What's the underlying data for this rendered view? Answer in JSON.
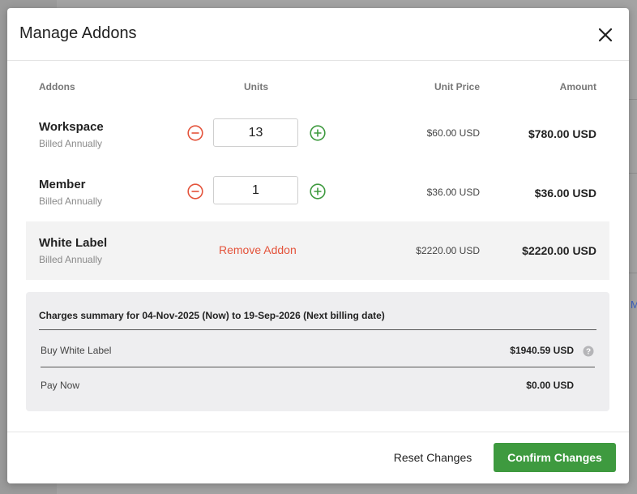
{
  "modal": {
    "title": "Manage Addons"
  },
  "table": {
    "headers": {
      "addons": "Addons",
      "units": "Units",
      "unit_price": "Unit Price",
      "amount": "Amount"
    },
    "rows": [
      {
        "name": "Workspace",
        "billing": "Billed Annually",
        "units": "13",
        "unit_price": "$60.00 USD",
        "amount": "$780.00 USD"
      },
      {
        "name": "Member",
        "billing": "Billed Annually",
        "units": "1",
        "unit_price": "$36.00 USD",
        "amount": "$36.00 USD"
      },
      {
        "name": "White Label",
        "billing": "Billed Annually",
        "action": "Remove Addon",
        "unit_price": "$2220.00 USD",
        "amount": "$2220.00 USD"
      }
    ]
  },
  "summary": {
    "title": "Charges summary for 04-Nov-2025 (Now) to 19-Sep-2026 (Next billing date)",
    "lines": [
      {
        "label": "Buy White Label",
        "value": "$1940.59 USD"
      },
      {
        "label": "Pay Now",
        "value": "$0.00 USD"
      }
    ]
  },
  "footer": {
    "reset_label": "Reset Changes",
    "confirm_label": "Confirm Changes"
  },
  "background": {
    "link_fragment": "M"
  },
  "icons": {
    "close": "close-icon",
    "decrement": "minus-circle-icon",
    "increment": "plus-circle-icon",
    "help": "help-circle-icon"
  },
  "colors": {
    "decrement": "#e4533b",
    "increment": "#3e9a3f",
    "confirm": "#3e9a3f",
    "remove_link": "#e4533b"
  }
}
